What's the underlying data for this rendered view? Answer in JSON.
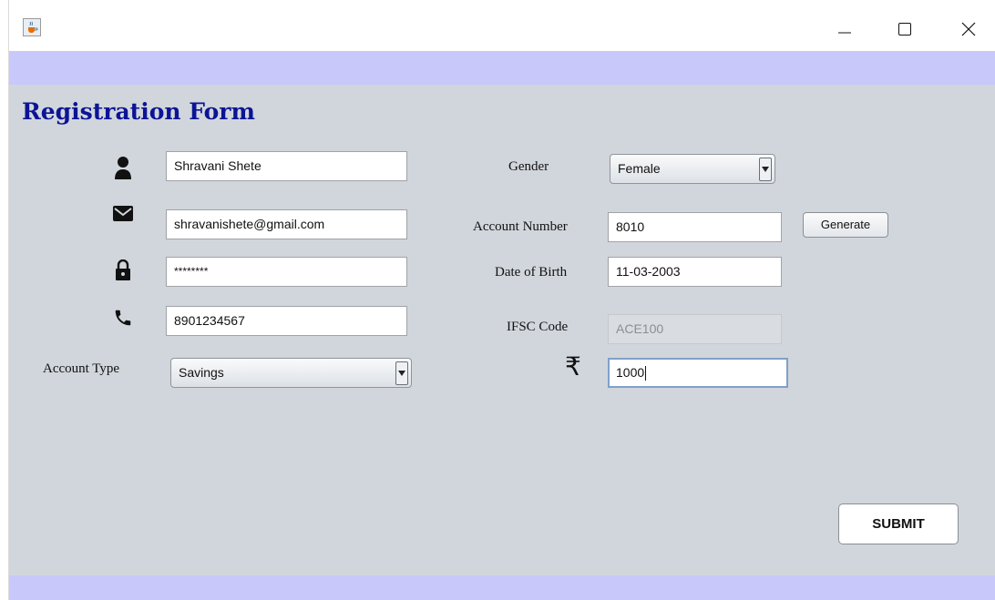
{
  "window": {
    "icon": "java-cup-icon",
    "controls": [
      "minimize-icon",
      "maximize-icon",
      "close-icon"
    ]
  },
  "form": {
    "heading": "Registration Form",
    "name_value": "Shravani Shete",
    "email_value": "shravanishete@gmail.com",
    "password_value": "********",
    "phone_value": "8901234567",
    "account_type_label": "Account Type",
    "account_type_value": "Savings",
    "gender_label": "Gender",
    "gender_value": "Female",
    "account_number_label": "Account Number",
    "account_number_value": "8010",
    "generate_label": "Generate",
    "dob_label": "Date of Birth",
    "dob_value": "11-03-2003",
    "ifsc_label": "IFSC Code",
    "ifsc_value": "ACE100",
    "rupee_symbol": "₹",
    "amount_value": "1000",
    "submit_label": "SUBMIT"
  },
  "colors": {
    "band": "#c8c8fa",
    "form_background": "#d1d6dc",
    "heading": "#0c1495"
  }
}
